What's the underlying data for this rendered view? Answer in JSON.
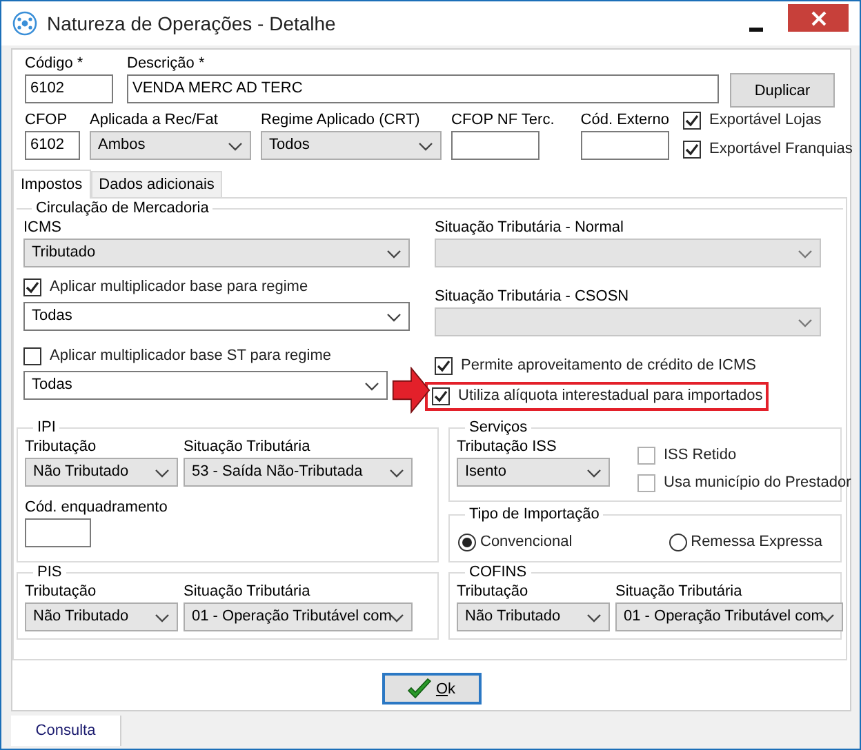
{
  "window": {
    "title": "Natureza de Operações - Detalhe"
  },
  "header": {
    "codigo": {
      "label": "Código *",
      "value": "6102"
    },
    "descricao": {
      "label": "Descrição *",
      "value": "VENDA MERC AD TERC"
    },
    "duplicar": "Duplicar",
    "cfop": {
      "label": "CFOP",
      "value": "6102"
    },
    "aplicada": {
      "label": "Aplicada a Rec/Fat",
      "value": "Ambos"
    },
    "regime": {
      "label": "Regime Aplicado (CRT)",
      "value": "Todos"
    },
    "cfop_nf_terc": {
      "label": "CFOP NF Terc."
    },
    "cod_externo": {
      "label": "Cód. Externo"
    },
    "exports": [
      {
        "label": "Exportável Lojas",
        "checked": true
      },
      {
        "label": "Exportável Franquias",
        "checked": true
      }
    ]
  },
  "tabs": [
    {
      "label": "Impostos",
      "selected": true
    },
    {
      "label": "Dados adicionais",
      "selected": false
    }
  ],
  "circulacao": {
    "title": "Circulação de Mercadoria",
    "icms": {
      "label": "ICMS",
      "value": "Tributado"
    },
    "multiplicador": {
      "label": "Aplicar multiplicador base para regime",
      "checked": true,
      "value": "Todas"
    },
    "multiplicador_st": {
      "label": "Aplicar multiplicador base ST para regime",
      "checked": false,
      "value": "Todas"
    },
    "situacao_normal": {
      "label": "Situação Tributária - Normal",
      "disabled": true
    },
    "situacao_csosn": {
      "label": "Situação Tributária - CSOSN",
      "disabled": true
    },
    "options": [
      {
        "label": "Permite aproveitamento de crédito de ICMS",
        "checked": true,
        "highlighted": false
      },
      {
        "label": "Utiliza alíquota interestadual para importados",
        "checked": true,
        "highlighted": true
      }
    ]
  },
  "ipi": {
    "title": "IPI",
    "tributacao": {
      "label": "Tributação",
      "value": "Não Tributado"
    },
    "situacao": {
      "label": "Situação Tributária",
      "value": "53 - Saída Não-Tributada"
    },
    "enquadramento": {
      "label": "Cód. enquadramento"
    }
  },
  "servicos": {
    "title": "Serviços",
    "tributacao": {
      "label": "Tributação ISS",
      "value": "Isento"
    },
    "options": [
      {
        "label": "ISS Retido",
        "checked": false
      },
      {
        "label": "Usa município do Prestador",
        "checked": false
      }
    ]
  },
  "importacao": {
    "title": "Tipo de Importação",
    "options": [
      {
        "label": "Convencional",
        "selected": true
      },
      {
        "label": "Remessa Expressa",
        "selected": false
      }
    ]
  },
  "pis": {
    "title": "PIS",
    "tributacao": {
      "label": "Tributação",
      "value": "Não Tributado"
    },
    "situacao": {
      "label": "Situação Tributária",
      "value": "01 - Operação Tributável com"
    }
  },
  "cofins": {
    "title": "COFINS",
    "tributacao": {
      "label": "Tributação",
      "value": "Não Tributado"
    },
    "situacao": {
      "label": "Situação Tributária",
      "value": "01 - Operação Tributável com"
    }
  },
  "ok_button": "Ok",
  "bottom_tabs": [
    {
      "label": "Consulta",
      "selected": true
    }
  ]
}
